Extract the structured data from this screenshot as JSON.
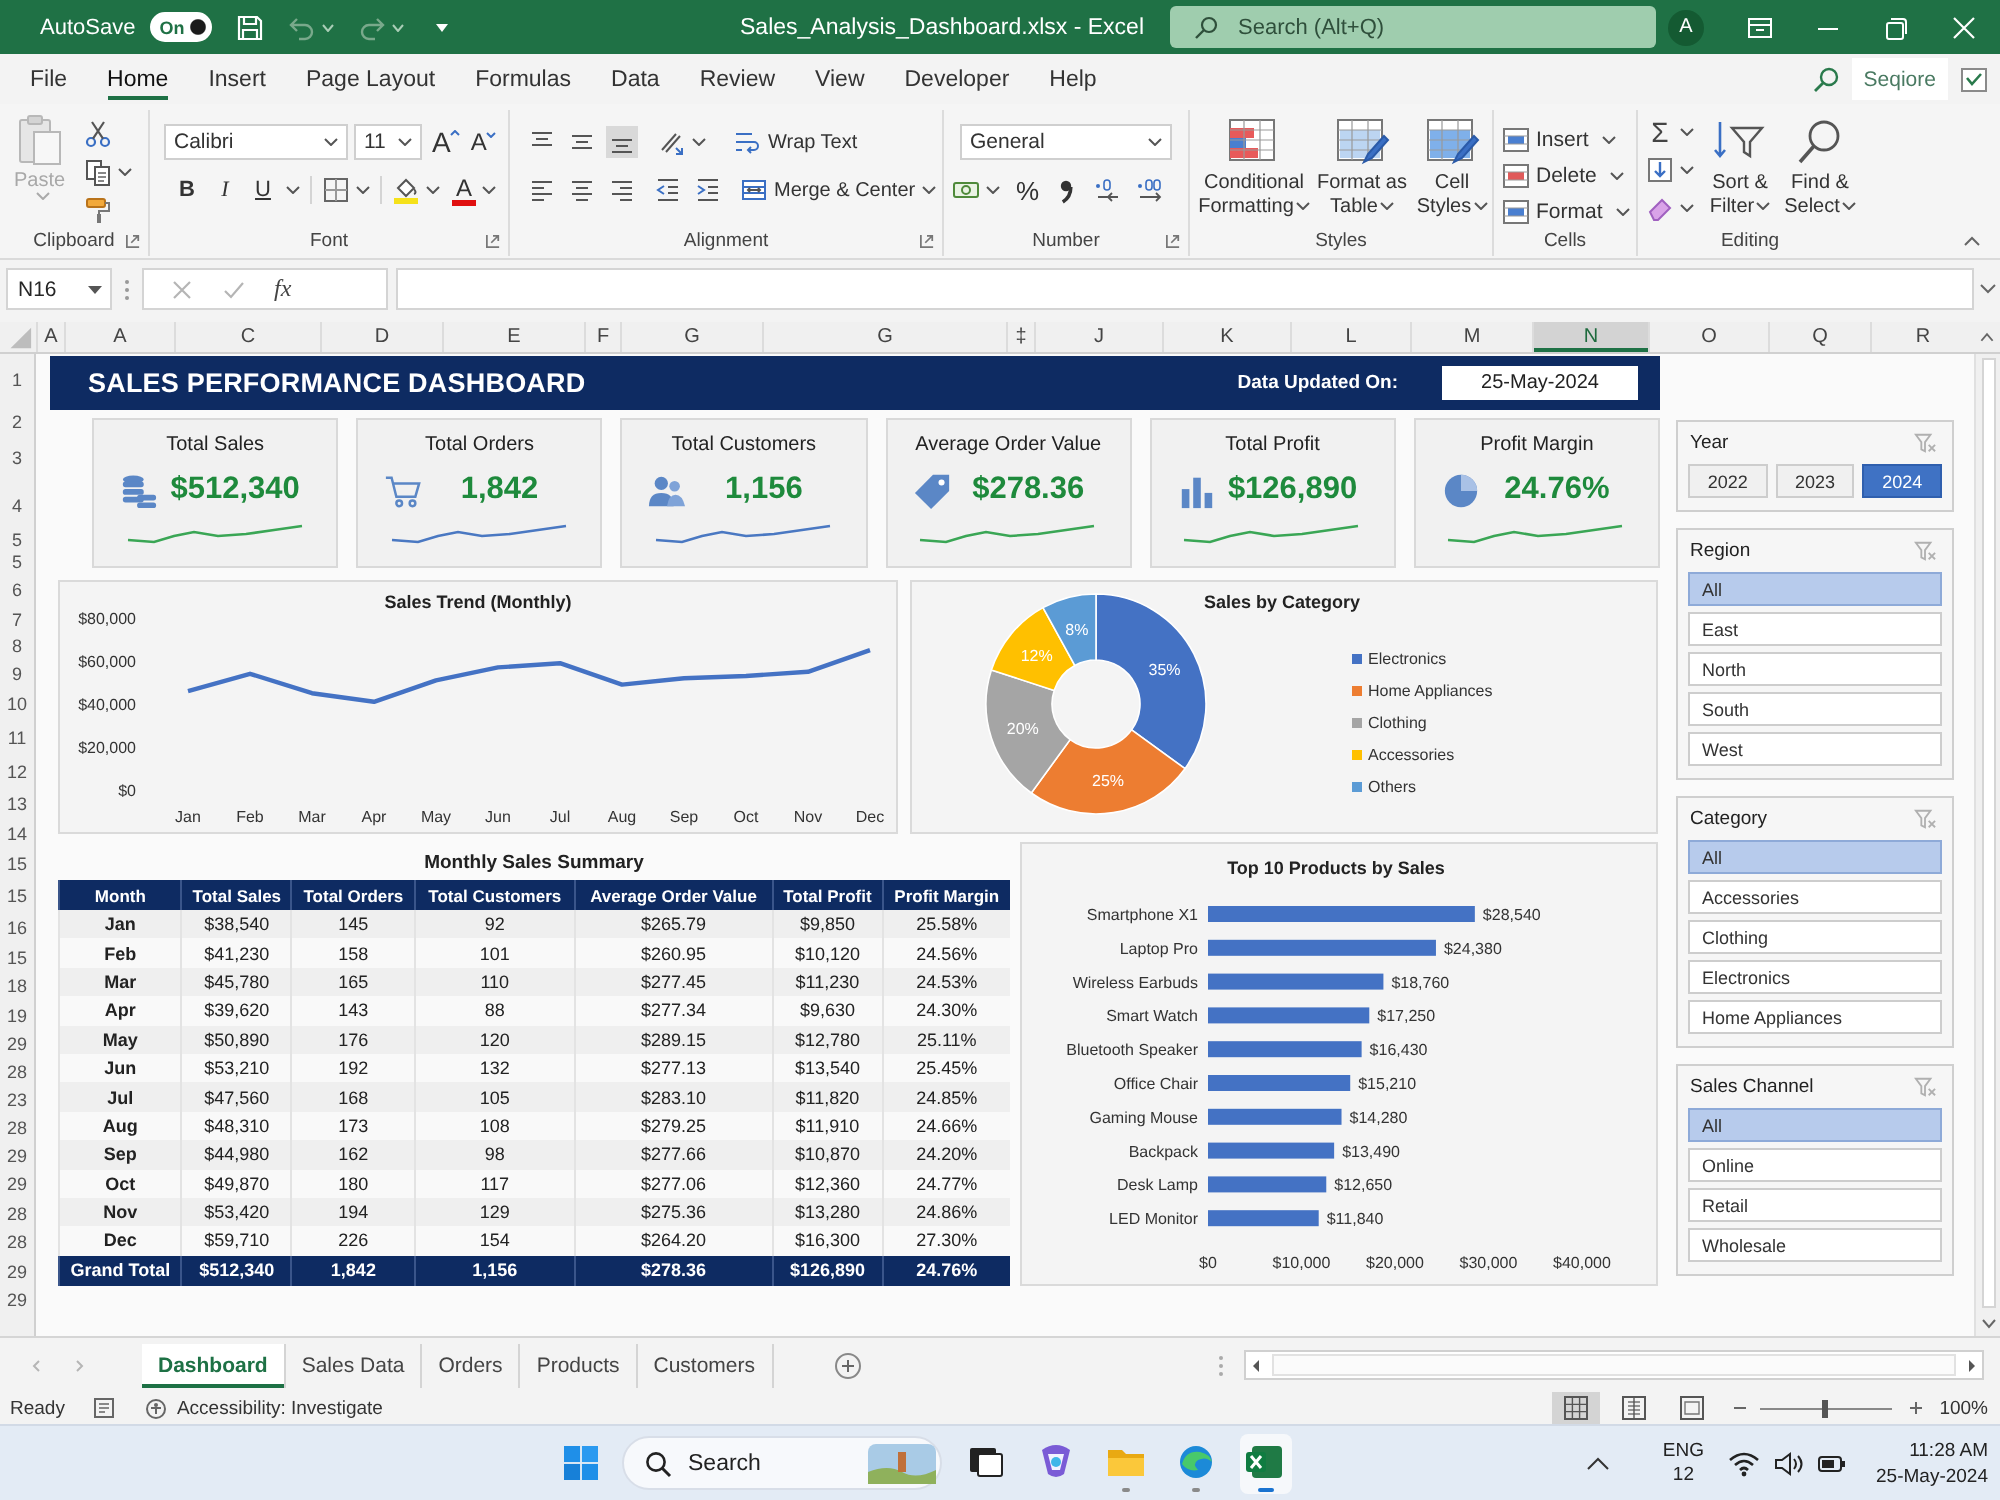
{
  "title_bar": {
    "autosave_label": "AutoSave",
    "autosave_toggle": {
      "label": "On",
      "on": true
    },
    "undo": {
      "disabled": true
    },
    "redo": {
      "disabled": true
    },
    "document_title": "Sales_Analysis_Dashboard.xlsx - Excel",
    "search": {
      "placeholder": "Search (Alt+Q)"
    },
    "avatar": "A"
  },
  "menu_tabs": [
    {
      "label": "File",
      "selected": false
    },
    {
      "label": "Home",
      "selected": true
    },
    {
      "label": "Insert",
      "selected": false
    },
    {
      "label": "Page Layout",
      "selected": false
    },
    {
      "label": "Formulas",
      "selected": false
    },
    {
      "label": "Data",
      "selected": false
    },
    {
      "label": "Review",
      "selected": false
    },
    {
      "label": "View",
      "selected": false
    },
    {
      "label": "Developer",
      "selected": false
    },
    {
      "label": "Help",
      "selected": false
    }
  ],
  "share_button": "Seqiore",
  "ribbon": {
    "clipboard": {
      "paste": {
        "label": "Paste",
        "disabled": true
      },
      "label": "Clipboard"
    },
    "font": {
      "family": "Calibri",
      "size": "11",
      "grow": "A",
      "shrink": "A",
      "styles": [
        "B",
        "I",
        "U"
      ],
      "font_color": "A",
      "label": "Font"
    },
    "alignment": {
      "vertical": [
        {
          "selected": false
        },
        {
          "selected": false
        },
        {
          "selected": true
        }
      ],
      "wrap_text": "Wrap Text",
      "merge": "Merge & Center",
      "label": "Alignment"
    },
    "number": {
      "format": "General",
      "percent": "%",
      "label": "Number"
    },
    "styles": {
      "buttons": [
        "Conditional Formatting",
        "Format as Table",
        "Cell Styles"
      ],
      "label": "Styles"
    },
    "cells": {
      "buttons": [
        "Insert",
        "Delete",
        "Format"
      ],
      "label": "Cells"
    },
    "editing": {
      "autosum": "Σ",
      "buttons": [
        "Sort & Filter",
        "Find & Select"
      ],
      "label": "Editing"
    }
  },
  "formula_bar": {
    "name_box": "N16",
    "function_label": "fx"
  },
  "column_headers": [
    {
      "label": "A",
      "selected": false
    },
    {
      "label": "A",
      "selected": false
    },
    {
      "label": "C",
      "selected": false
    },
    {
      "label": "D",
      "selected": false
    },
    {
      "label": "E",
      "selected": false
    },
    {
      "label": "F",
      "selected": false
    },
    {
      "label": "G",
      "selected": false
    },
    {
      "label": "G",
      "selected": false
    },
    {
      "label": "‡",
      "selected": false
    },
    {
      "label": "J",
      "selected": false
    },
    {
      "label": "K",
      "selected": false
    },
    {
      "label": "L",
      "selected": false
    },
    {
      "label": "M",
      "selected": false
    },
    {
      "label": "N",
      "selected": true
    },
    {
      "label": "O",
      "selected": false
    },
    {
      "label": "Q",
      "selected": false
    },
    {
      "label": "R",
      "selected": false
    }
  ],
  "row_headers": [
    "1",
    "2",
    "3",
    "4",
    "5",
    "5",
    "6",
    "7",
    "8",
    "9",
    "10",
    "11",
    "12",
    "13",
    "14",
    "15",
    "15",
    "16",
    "15",
    "18",
    "19",
    "29",
    "28",
    "23",
    "28",
    "29",
    "29",
    "28",
    "28",
    "29",
    "29"
  ],
  "dashboard": {
    "title": "SALES PERFORMANCE DASHBOARD",
    "updated_label": "Data Updated On:",
    "updated_date": "25-May-2024"
  },
  "kpi_cards": [
    {
      "label": "Total Sales",
      "value": "$512,340",
      "color": "#3aa655"
    },
    {
      "label": "Total Orders",
      "value": "1,842",
      "color": "#4a78c2"
    },
    {
      "label": "Total Customers",
      "value": "1,156",
      "color": "#4a78c2"
    },
    {
      "label": "Average Order Value",
      "value": "$278.36",
      "color": "#3aa655"
    },
    {
      "label": "Total Profit",
      "value": "$126,890",
      "color": "#3aa655"
    },
    {
      "label": "Profit Margin",
      "value": "24.76%",
      "color": "#3aa655"
    }
  ],
  "sales_trend": {
    "chart_data": [
      {
        "type": "line",
        "title": "Sales Trend (Monthly)",
        "categories": [
          "Jan",
          "Feb",
          "Mar",
          "Apr",
          "May",
          "Jun",
          "Jul",
          "Aug",
          "Sep",
          "Oct",
          "Nov",
          "Dec"
        ],
        "values": [
          46000,
          54000,
          45000,
          41000,
          51000,
          57000,
          59000,
          49000,
          52000,
          53000,
          55000,
          65000
        ],
        "color": "#4472c4",
        "ylim": [
          0,
          80000
        ],
        "yticks": [
          {
            "value": 0,
            "label": "$0"
          },
          {
            "value": 20000,
            "label": "$20,000"
          },
          {
            "value": 40000,
            "label": "$40,000"
          },
          {
            "value": 60000,
            "label": "$60,000"
          },
          {
            "value": 80000,
            "label": "$80,000"
          }
        ]
      }
    ]
  },
  "sales_by_category": {
    "chart_data": [
      {
        "type": "donut",
        "title": "Sales by Category",
        "categories": [
          "Electronics",
          "Home Appliances",
          "Clothing",
          "Accessories",
          "Others"
        ],
        "values": [
          35,
          25,
          20,
          12,
          8
        ],
        "colors": [
          "#4472c4",
          "#ed7d31",
          "#a5a5a5",
          "#ffc000",
          "#5b9bd5"
        ],
        "value_labels": [
          "35%",
          "25%",
          "20%",
          "12%",
          "8%"
        ],
        "legend": "right"
      }
    ]
  },
  "monthly_summary": {
    "title": "Monthly Sales Summary",
    "columns": [
      "Month",
      "Total Sales",
      "Total Orders",
      "Total Customers",
      "Average Order Value",
      "Total Profit",
      "Profit Margin"
    ],
    "rows": [
      [
        "Jan",
        "$38,540",
        "145",
        "92",
        "$265.79",
        "$9,850",
        "25.58%"
      ],
      [
        "Feb",
        "$41,230",
        "158",
        "101",
        "$260.95",
        "$10,120",
        "24.56%"
      ],
      [
        "Mar",
        "$45,780",
        "165",
        "110",
        "$277.45",
        "$11,230",
        "24.53%"
      ],
      [
        "Apr",
        "$39,620",
        "143",
        "88",
        "$277.34",
        "$9,630",
        "24.30%"
      ],
      [
        "May",
        "$50,890",
        "176",
        "120",
        "$289.15",
        "$12,780",
        "25.11%"
      ],
      [
        "Jun",
        "$53,210",
        "192",
        "132",
        "$277.13",
        "$13,540",
        "25.45%"
      ],
      [
        "Jul",
        "$47,560",
        "168",
        "105",
        "$283.10",
        "$11,820",
        "24.85%"
      ],
      [
        "Aug",
        "$48,310",
        "173",
        "108",
        "$279.25",
        "$11,910",
        "24.66%"
      ],
      [
        "Sep",
        "$44,980",
        "162",
        "98",
        "$277.66",
        "$10,870",
        "24.20%"
      ],
      [
        "Oct",
        "$49,870",
        "180",
        "117",
        "$277.06",
        "$12,360",
        "24.77%"
      ],
      [
        "Nov",
        "$53,420",
        "194",
        "129",
        "$275.36",
        "$13,280",
        "24.86%"
      ],
      [
        "Dec",
        "$59,710",
        "226",
        "154",
        "$264.20",
        "$16,300",
        "27.30%"
      ]
    ],
    "total_row": [
      "Grand Total",
      "$512,340",
      "1,842",
      "1,156",
      "$278.36",
      "$126,890",
      "24.76%"
    ]
  },
  "top_products": {
    "chart_data": [
      {
        "type": "bar",
        "orientation": "horizontal",
        "title": "Top 10 Products by Sales",
        "categories": [
          "Smartphone X1",
          "Laptop Pro",
          "Wireless Earbuds",
          "Smart Watch",
          "Bluetooth Speaker",
          "Office Chair",
          "Gaming Mouse",
          "Backpack",
          "Desk Lamp",
          "LED Monitor"
        ],
        "values": [
          28540,
          24380,
          18760,
          17250,
          16430,
          15210,
          14280,
          13490,
          12650,
          11840
        ],
        "color": "#4472c4",
        "value_labels": [
          "$28,540",
          "$24,380",
          "$18,760",
          "$17,250",
          "$16,430",
          "$15,210",
          "$14,280",
          "$13,490",
          "$12,650",
          "$11,840"
        ],
        "xlim": [
          0,
          40000
        ],
        "xticks": [
          {
            "value": 0,
            "label": "$0"
          },
          {
            "value": 10000,
            "label": "$10,000"
          },
          {
            "value": 20000,
            "label": "$20,000"
          },
          {
            "value": 30000,
            "label": "$30,000"
          },
          {
            "value": 40000,
            "label": "$40,000"
          }
        ]
      }
    ]
  },
  "slicers": [
    {
      "title": "Year",
      "kind": "row",
      "items": [
        {
          "label": "2022",
          "selected": false
        },
        {
          "label": "2023",
          "selected": false
        },
        {
          "label": "2024",
          "selected": true
        }
      ]
    },
    {
      "title": "Region",
      "kind": "list",
      "items": [
        {
          "label": "All",
          "selected": true
        },
        {
          "label": "East",
          "selected": false
        },
        {
          "label": "North",
          "selected": false
        },
        {
          "label": "South",
          "selected": false
        },
        {
          "label": "West",
          "selected": false
        }
      ]
    },
    {
      "title": "Category",
      "kind": "list",
      "items": [
        {
          "label": "All",
          "selected": true
        },
        {
          "label": "Accessories",
          "selected": false
        },
        {
          "label": "Clothing",
          "selected": false
        },
        {
          "label": "Electronics",
          "selected": false
        },
        {
          "label": "Home Appliances",
          "selected": false
        }
      ]
    },
    {
      "title": "Sales Channel",
      "kind": "list",
      "items": [
        {
          "label": "All",
          "selected": true
        },
        {
          "label": "Online",
          "selected": false
        },
        {
          "label": "Retail",
          "selected": false
        },
        {
          "label": "Wholesale",
          "selected": false
        }
      ]
    }
  ],
  "sheet_tabs": [
    {
      "label": "Dashboard",
      "selected": true
    },
    {
      "label": "Sales Data",
      "selected": false
    },
    {
      "label": "Orders",
      "selected": false
    },
    {
      "label": "Products",
      "selected": false
    },
    {
      "label": "Customers",
      "selected": false
    }
  ],
  "status_bar": {
    "mode": "Ready",
    "accessibility": "Accessibility: Investigate",
    "views": [
      {
        "selected": true
      },
      {
        "selected": false
      },
      {
        "selected": false
      }
    ],
    "zoom": {
      "level": 0.5,
      "label": "100%"
    }
  },
  "taskbar": {
    "search": {
      "placeholder": "Search"
    },
    "apps": [
      {
        "running": false,
        "selected": false
      },
      {
        "running": false,
        "selected": false
      },
      {
        "running": true,
        "selected": false
      },
      {
        "running": true,
        "selected": false
      },
      {
        "running": true,
        "selected": true
      }
    ],
    "language": "ENG",
    "keyboard": "12",
    "time": "11:28 AM",
    "date": "25-May-2024"
  }
}
